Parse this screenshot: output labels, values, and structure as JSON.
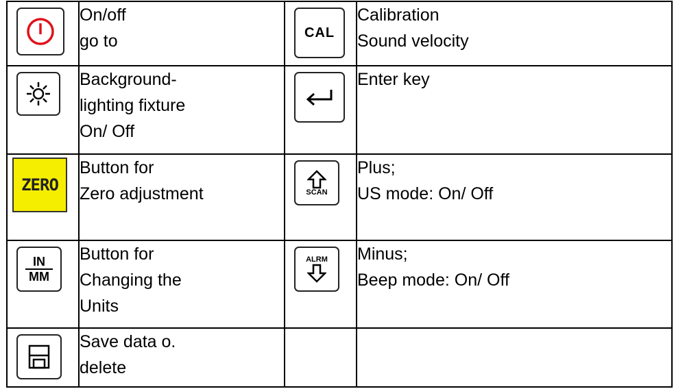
{
  "rows": [
    {
      "left_icon": "power-icon",
      "left_lines": [
        "On/off",
        "go to"
      ],
      "right_icon": "cal-key",
      "right_key_label": "CAL",
      "right_lines": [
        "Calibration",
        "Sound velocity"
      ]
    },
    {
      "left_icon": "backlight-icon",
      "left_lines": [
        "Background-",
        "lighting fixture",
        "On/ Off"
      ],
      "right_icon": "enter-icon",
      "right_lines": [
        "Enter key"
      ]
    },
    {
      "left_icon": "zero-key",
      "left_key_label": "ZERO",
      "left_key_color": "#f5ee00",
      "left_lines": [
        "Button for",
        "Zero adjustment"
      ],
      "right_icon": "up-arrow-icon",
      "right_key_label": "SCAN",
      "right_lines": [
        "Plus;",
        "US mode: On/ Off"
      ]
    },
    {
      "left_icon": "units-key",
      "left_key_label_top": "IN",
      "left_key_label_bottom": "MM",
      "left_lines": [
        "Button for",
        "Changing the",
        "Units"
      ],
      "right_icon": "down-arrow-icon",
      "right_key_label": "ALRM",
      "right_lines": [
        "Minus;",
        "Beep mode: On/ Off"
      ]
    },
    {
      "left_icon": "save-icon",
      "left_lines": [
        "Save data o.",
        "delete"
      ]
    }
  ],
  "colors": {
    "power": "#e0121b",
    "zero_key": "#f5ee00",
    "border": "#000000"
  }
}
